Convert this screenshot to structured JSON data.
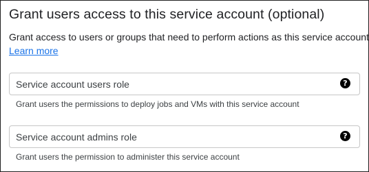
{
  "section": {
    "title": "Grant users access to this service account (optional)",
    "description": "Grant access to users or groups that need to perform actions as this service account.",
    "learn_more_label": "Learn more"
  },
  "fields": [
    {
      "label": "Service account users role",
      "help_icon": "help-circle-icon",
      "help_glyph": "?",
      "hint": "Grant users the permissions to deploy jobs and VMs with this service account"
    },
    {
      "label": "Service account admins role",
      "help_icon": "help-circle-icon",
      "help_glyph": "?",
      "hint": "Grant users the permission to administer this service account"
    }
  ],
  "colors": {
    "link": "#1a73e8",
    "text": "#202124",
    "border": "#c6c6c6"
  }
}
